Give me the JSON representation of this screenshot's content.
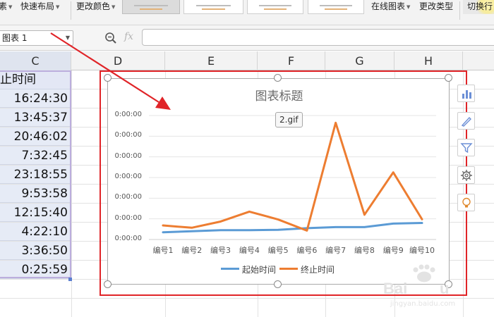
{
  "ribbon": {
    "items": [
      {
        "label": "素",
        "dropdown": true
      },
      {
        "label": "快速布局",
        "dropdown": true
      },
      {
        "label": "更改颜色",
        "dropdown": true
      },
      {
        "label": "在线图表",
        "dropdown": true
      },
      {
        "label": "更改类型",
        "dropdown": false
      }
    ],
    "cut_label": "切换行"
  },
  "formula_bar": {
    "name_box": "图表 1",
    "fx": "fx",
    "formula": ""
  },
  "sheet": {
    "columns": [
      "C",
      "D",
      "E",
      "F",
      "G",
      "H"
    ],
    "c_header": "止时间",
    "c_values": [
      "16:24:30",
      "13:45:37",
      "20:46:02",
      "7:32:45",
      "23:18:55",
      "9:53:58",
      "12:15:40",
      "4:22:10",
      "3:36:50",
      "0:25:59"
    ]
  },
  "chart": {
    "title": "图表标题",
    "tooltip": "2.gif",
    "colors": {
      "start": "#5b9bd5",
      "end": "#ed7d31"
    }
  },
  "chart_data": {
    "type": "line",
    "title": "图表标题",
    "categories": [
      "编号1",
      "编号2",
      "编号3",
      "编号4",
      "编号5",
      "编号6",
      "编号7",
      "编号8",
      "编号9",
      "编号10"
    ],
    "y_tick_labels": [
      "0:00:00",
      "0:00:00",
      "0:00:00",
      "0:00:00",
      "0:00:00",
      "0:00:00",
      "0:00:00"
    ],
    "ylim": [
      0,
      6
    ],
    "grid": true,
    "legend_position": "bottom",
    "series": [
      {
        "name": "起始时间",
        "color": "#5b9bd5",
        "values": [
          0.35,
          0.4,
          0.45,
          0.45,
          0.47,
          0.55,
          0.6,
          0.6,
          0.77,
          0.8
        ]
      },
      {
        "name": "终止时间",
        "color": "#ed7d31",
        "values": [
          0.68,
          0.57,
          0.87,
          1.35,
          0.97,
          0.43,
          5.65,
          1.2,
          3.25,
          0.98
        ]
      }
    ]
  }
}
